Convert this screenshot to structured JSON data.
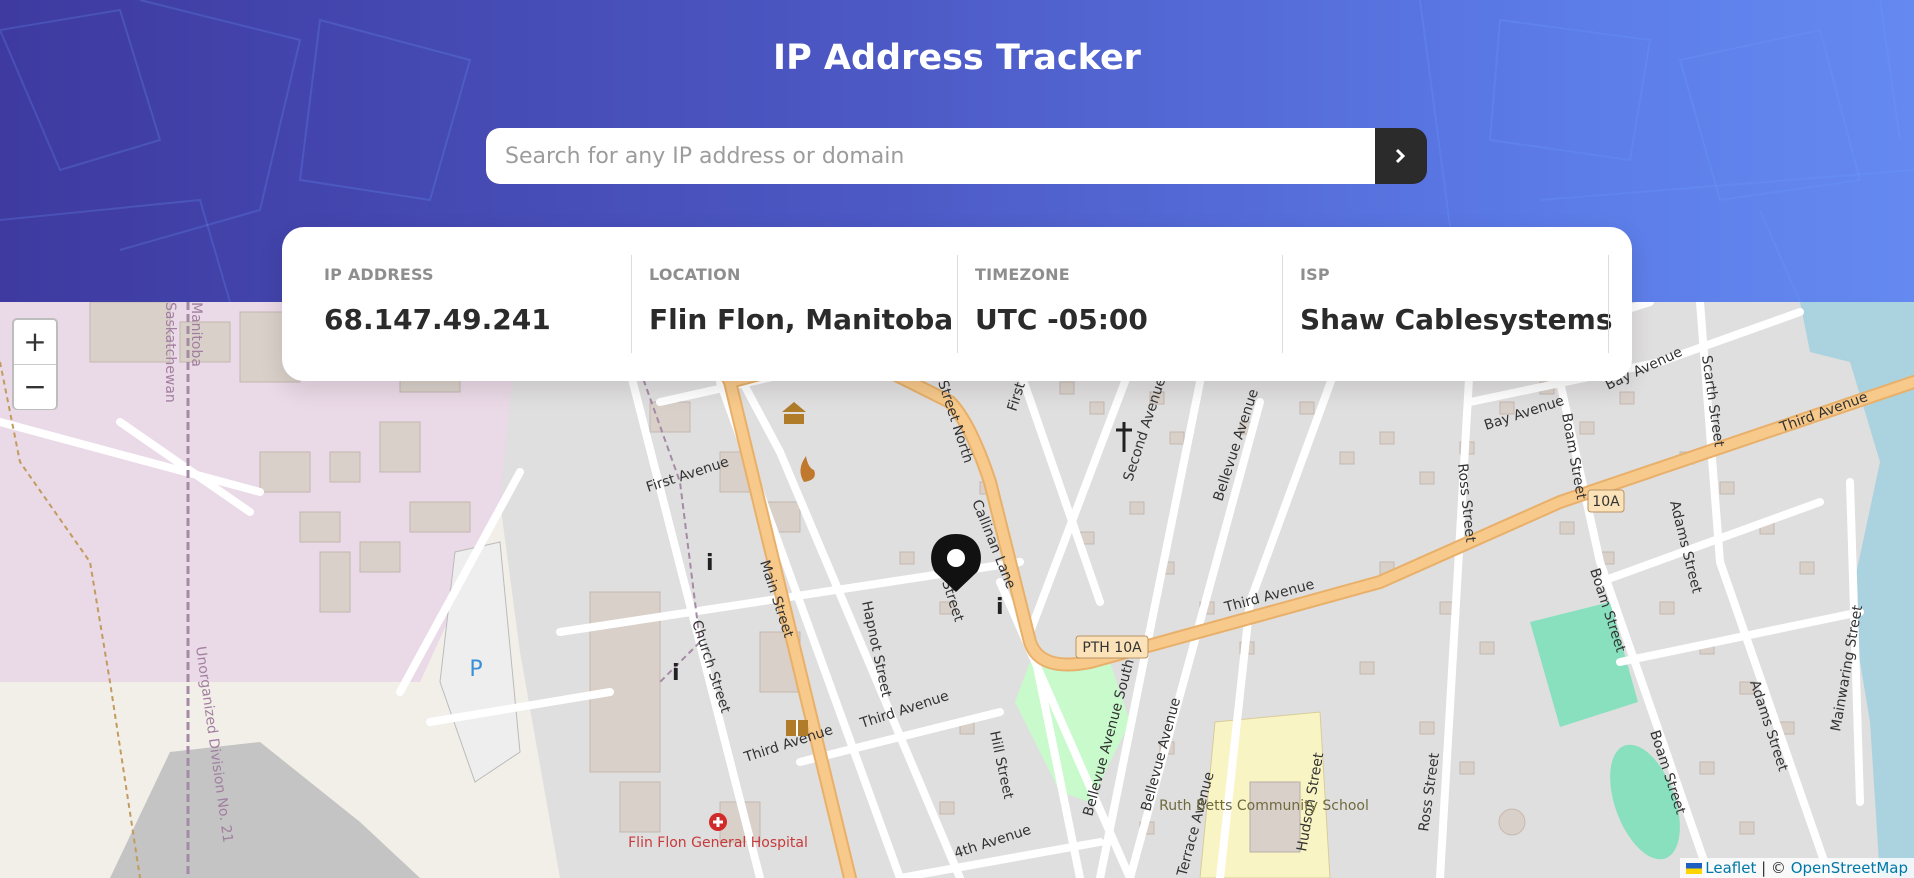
{
  "header": {
    "title": "IP Address Tracker"
  },
  "search": {
    "placeholder": "Search for any IP address or domain",
    "value": "",
    "button_icon": "chevron-right-icon"
  },
  "info": [
    {
      "label": "IP ADDRESS",
      "value": "68.147.49.241"
    },
    {
      "label": "LOCATION",
      "value": "Flin Flon, Manitoba"
    },
    {
      "label": "TIMEZONE",
      "value": "UTC -05:00"
    },
    {
      "label": "ISP",
      "value": "Shaw Cablesystems"
    }
  ],
  "map": {
    "zoom_in": "+",
    "zoom_out": "−",
    "marker_icon": "location-pin-icon",
    "labels": {
      "main_street": "Main Street",
      "first_avenue": "First Avenue",
      "church_street": "Church Street",
      "hapnot_street": "Hapnot Street",
      "third_avenue_w": "Third Avenue",
      "third_avenue_w2": "Third Avenue",
      "third_avenue_c": "Third Avenue",
      "third_avenue_e": "Third Avenue",
      "callinan_lane": "Callinan Lane",
      "hill_street": "Hill Street",
      "pth": "PTH 10A",
      "route_10a": "10A",
      "bellevue_south": "Bellevue Avenue South",
      "bellevue_avenue": "Bellevue Avenue",
      "bellevue_avenue_n": "Bellevue Avenue",
      "second_avenue": "Second Avenue East",
      "bay_avenue": "Bay Avenue",
      "bay_avenue2": "Bay Avenue",
      "boam_street": "Boam Street",
      "boam_street2": "Boam Street",
      "boam_street3": "Boam Street",
      "ross_street": "Ross Street",
      "ross_street2": "Ross Street",
      "adams_street": "Adams Street",
      "adams_street2": "Adams Street",
      "scarth_street": "Scarth Street",
      "mainwaring_street": "Mainwaring Street",
      "hudson_street": "Hudson Street",
      "terrace_avenue": "Terrace Avenue",
      "fourth_avenue": "4th Avenue",
      "school": "Ruth Betts Community School",
      "hospital": "Flin Flon General Hospital",
      "unorganized": "Unorganized Division No. 21",
      "manitoba": "Manitoba",
      "saskatchewan": "Saskatchewan",
      "street_north": "Street North",
      "first": "First",
      "street": "Street",
      "parking": "P"
    },
    "attribution": {
      "leaflet": "Leaflet",
      "separator": " | © ",
      "osm": "OpenStreetMap"
    }
  },
  "colors": {
    "header_start": "#3e3aa0",
    "header_end": "#6489f0",
    "road_major": "#f7c98a",
    "park": "#c8facc",
    "field": "#88e0be",
    "water": "#aad3df",
    "land_pink": "#ead9e6"
  }
}
